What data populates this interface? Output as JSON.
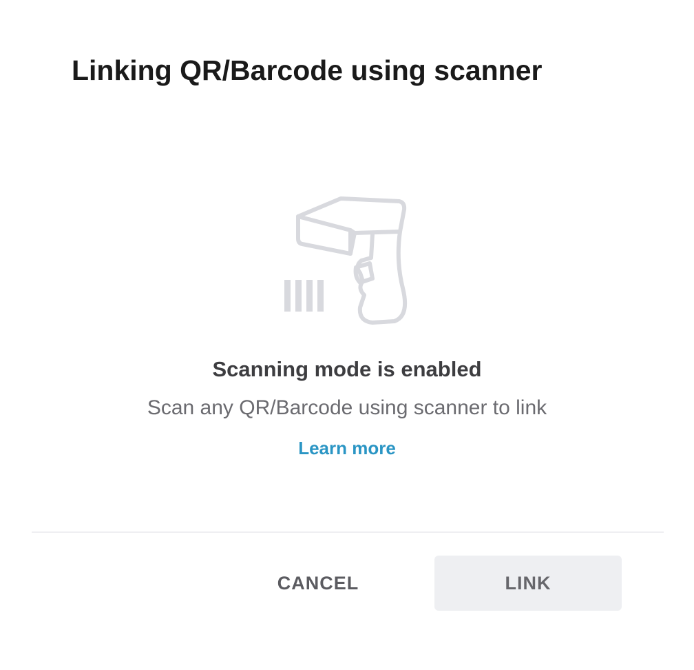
{
  "dialog": {
    "title": "Linking QR/Barcode using scanner",
    "icon": "barcode-scanner-icon",
    "status_heading": "Scanning mode is enabled",
    "status_subtext": "Scan any QR/Barcode using scanner to link",
    "learn_more_label": "Learn more",
    "cancel_label": "CANCEL",
    "link_label": "LINK"
  },
  "colors": {
    "icon_stroke": "#d8d9de",
    "link_accent": "#2a95c4",
    "link_button_bg": "#eeeff2",
    "divider": "#efeff2"
  }
}
